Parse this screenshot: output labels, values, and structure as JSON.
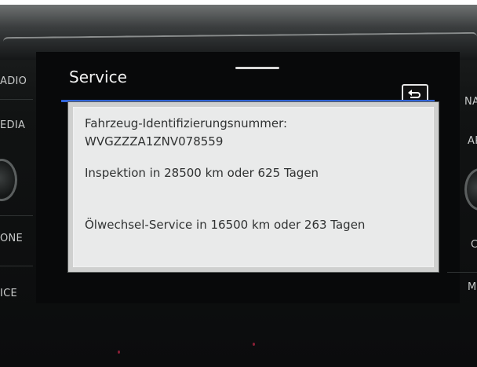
{
  "header": {
    "title": "Service"
  },
  "side_menu": {
    "left": [
      "ADIO",
      "EDIA",
      "ONE",
      "ICE"
    ],
    "right": [
      "NA",
      "AP",
      "C",
      "MI"
    ]
  },
  "vehicle": {
    "vin_label": "Fahrzeug-Identifizierungsnummer:",
    "vin": "WVGZZZA1ZNV078559"
  },
  "service": {
    "inspection": "Inspektion in 28500 km oder 625 Tagen",
    "oil_change": "Ölwechsel-Service in 16500 km oder 263 Tagen"
  },
  "icons": {
    "back": "back-arrow-icon",
    "drawer": "drawer-handle"
  },
  "colors": {
    "accent": "#2f63d8",
    "panel_bg": "#e9eaea",
    "text": "#303232"
  }
}
